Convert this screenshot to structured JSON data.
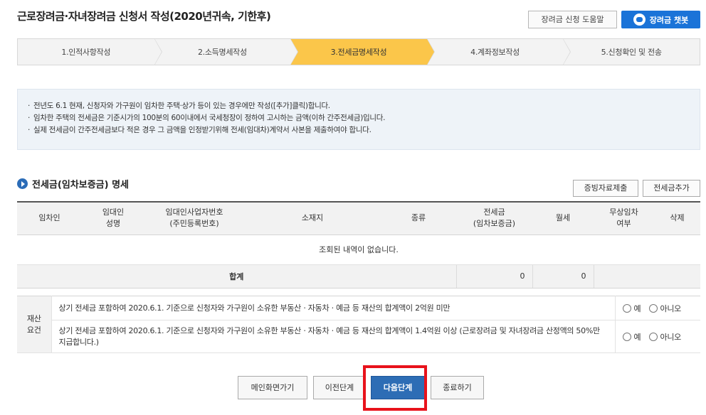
{
  "header": {
    "title": "근로장려금·자녀장려금 신청서 작성(2020년귀속, 기한후)",
    "help_button": "장려금 신청 도움말",
    "chatbot_button": "장려금 챗봇"
  },
  "steps": [
    {
      "label": "1.인적사항작성"
    },
    {
      "label": "2.소득명세작성"
    },
    {
      "label": "3.전세금명세작성"
    },
    {
      "label": "4.계좌정보작성"
    },
    {
      "label": "5.신청확인 및 전송"
    }
  ],
  "notice": [
    "전년도 6.1 현재, 신청자와 가구원이 임차한 주택·상가 등이 있는 경우에만 작성([추가]클릭)합니다.",
    "임차한 주택의 전세금은 기준시가의 100분의 60이내에서 국세청장이 정하여 고시하는 금액(이하 간주전세금)입니다.",
    "실제 전세금이 간주전세금보다 적은 경우 그 금액을 인정받기위해 전세(임대차)계약서 사본을 제출하여야 합니다."
  ],
  "section": {
    "title": "전세금(임차보증금) 명세",
    "evidence_button": "증빙자료제출",
    "add_button": "전세금추가"
  },
  "table": {
    "headers": [
      {
        "line1": "임차인",
        "line2": ""
      },
      {
        "line1": "임대인",
        "line2": "성명"
      },
      {
        "line1": "임대인사업자번호",
        "line2": "(주민등록번호)"
      },
      {
        "line1": "소재지",
        "line2": ""
      },
      {
        "line1": "종류",
        "line2": ""
      },
      {
        "line1": "전세금",
        "line2": "(임차보증금)"
      },
      {
        "line1": "월세",
        "line2": ""
      },
      {
        "line1": "무상임차",
        "line2": "여부"
      },
      {
        "line1": "삭제",
        "line2": ""
      }
    ],
    "empty_message": "조회된 내역이 없습니다.",
    "sum_label": "합계",
    "sum_deposit": "0",
    "sum_monthly": "0"
  },
  "property": {
    "label_line1": "재산",
    "label_line2": "요건",
    "rows": [
      {
        "text": "상기 전세금 포함하여 2020.6.1. 기준으로 신청자와 가구원이 소유한 부동산ㆍ자동차ㆍ예금 등 재산의 합계액이 2억원 미만",
        "yes": "예",
        "no": "아니오"
      },
      {
        "text": "상기 전세금 포함하여 2020.6.1. 기준으로 신청자와 가구원이 소유한 부동산ㆍ자동차ㆍ예금 등 재산의 합계액이 1.4억원 이상 (근로장려금 및 자녀장려금 산정액의 50%만 지급합니다.)",
        "yes": "예",
        "no": "아니오"
      }
    ]
  },
  "footer": {
    "main_button": "메인화면가기",
    "prev_button": "이전단계",
    "next_button": "다음단계",
    "exit_button": "종료하기"
  },
  "colors": {
    "active_step": "#fbc64a",
    "primary_button": "#2d6db5",
    "chatbot_button": "#1a73d8",
    "highlight_box": "#e8121b"
  }
}
